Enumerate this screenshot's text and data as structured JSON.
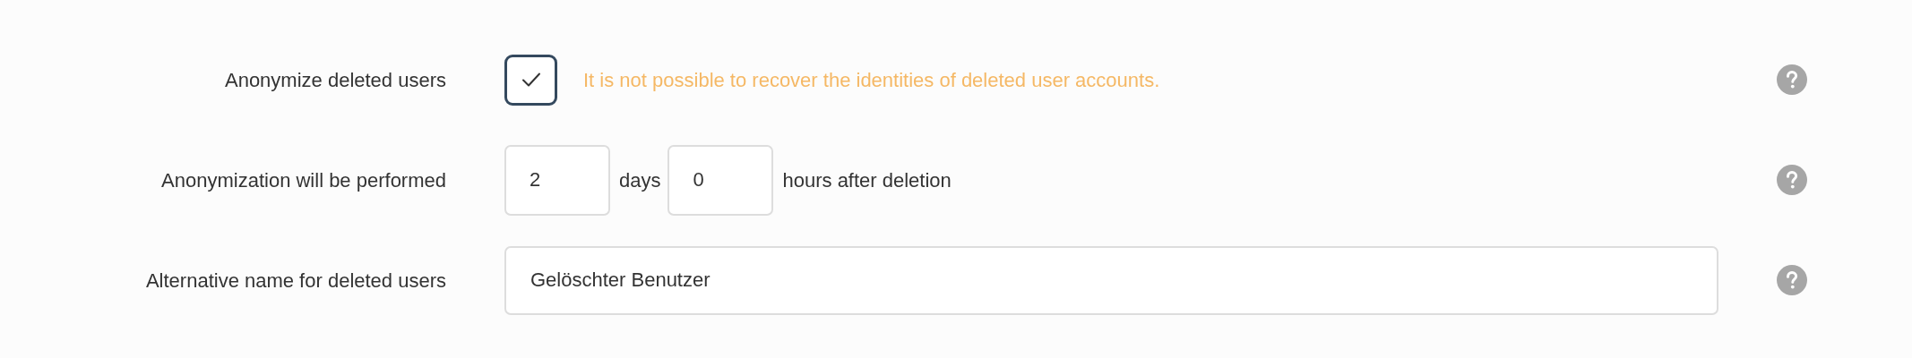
{
  "settings": [
    {
      "kind": "checkbox",
      "label": "Anonymize deleted users",
      "checked": true,
      "warning": "It is not possible to recover the identities of deleted user accounts."
    },
    {
      "kind": "duration",
      "label": "Anonymization will be performed",
      "days": "2",
      "days_unit": "days",
      "hours": "0",
      "hours_unit": "hours after deletion"
    },
    {
      "kind": "text",
      "label": "Alternative name for deleted users",
      "value": "Gelöschter Benutzer"
    }
  ]
}
